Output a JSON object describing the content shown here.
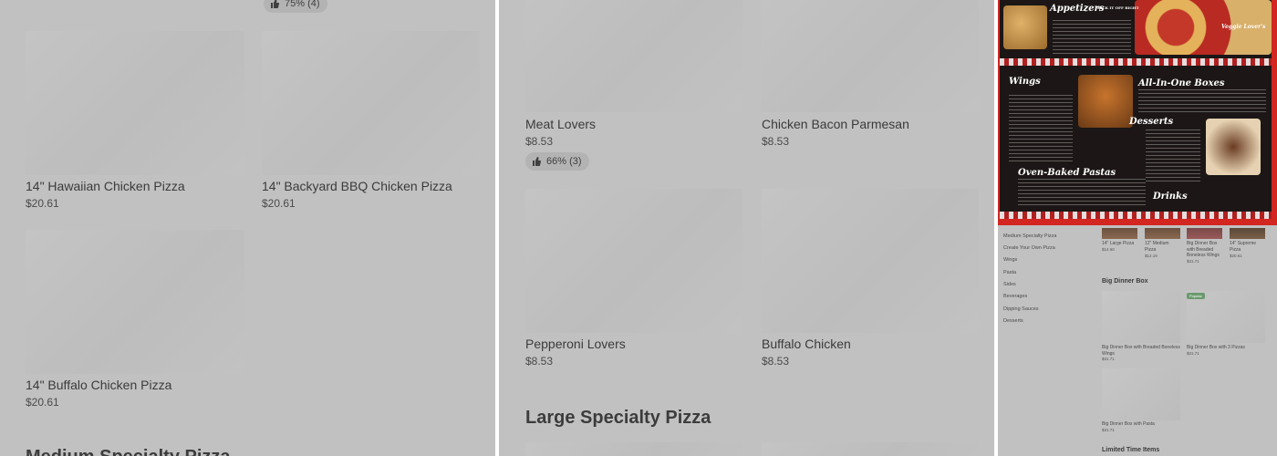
{
  "left_panel": {
    "top_rating": "75% (4)",
    "items": [
      {
        "name": "14\" Hawaiian Chicken Pizza",
        "price": "$20.61"
      },
      {
        "name": "14\" Backyard BBQ Chicken Pizza",
        "price": "$20.61"
      },
      {
        "name": "14\" Buffalo Chicken Pizza",
        "price": "$20.61"
      }
    ],
    "next_section": "Medium Specialty Pizza"
  },
  "middle_panel": {
    "items": [
      {
        "name": "Meat Lovers",
        "price": "$8.53",
        "rating": "66% (3)"
      },
      {
        "name": "Chicken Bacon Parmesan",
        "price": "$8.53"
      },
      {
        "name": "Pepperoni Lovers",
        "price": "$8.53"
      },
      {
        "name": "Buffalo Chicken",
        "price": "$8.53"
      }
    ],
    "section_title": "Large Specialty Pizza"
  },
  "right_panel": {
    "menu_board": {
      "appetizers": "Appetizers",
      "appetizers_tag": "KICK IT OFF RIGHT",
      "veggie": "Veggie Lover's",
      "wings": "Wings",
      "all_in_one": "All-In-One Boxes",
      "desserts": "Desserts",
      "pastas": "Oven-Baked Pastas",
      "drinks": "Drinks"
    },
    "sidebar": [
      "Medium Specialty Pizza",
      "Create Your Own Pizza",
      "Wings",
      "Pasta",
      "Sides",
      "Beverages",
      "Dipping Sauces",
      "Desserts"
    ],
    "top_row": [
      {
        "name": "14\" Large Pizza",
        "price": "$14.60"
      },
      {
        "name": "12\" Medium Pizza",
        "price": "$12.19"
      },
      {
        "name": "Big Dinner Box with Breaded Boneless Wings",
        "price": "$31.71"
      },
      {
        "name": "14\" Supreme Pizza",
        "price": "$20.61"
      }
    ],
    "big_dinner_title": "Big Dinner Box",
    "popular_badge": "Popular",
    "big_dinner_items": [
      {
        "name": "Big Dinner Box with Breaded Boneless Wings",
        "price": "$31.71"
      },
      {
        "name": "Big Dinner Box with 3 Pizzas",
        "price": "$31.71"
      },
      {
        "name": "Big Dinner Box with Pasta",
        "price": "$31.71"
      }
    ],
    "limited_title": "Limited Time Items"
  },
  "colors": {
    "overlay_gray": "#c1c1c1",
    "menu_red": "#d32621",
    "board_dark": "#1c1716",
    "popular_green": "#6a9a6e"
  }
}
